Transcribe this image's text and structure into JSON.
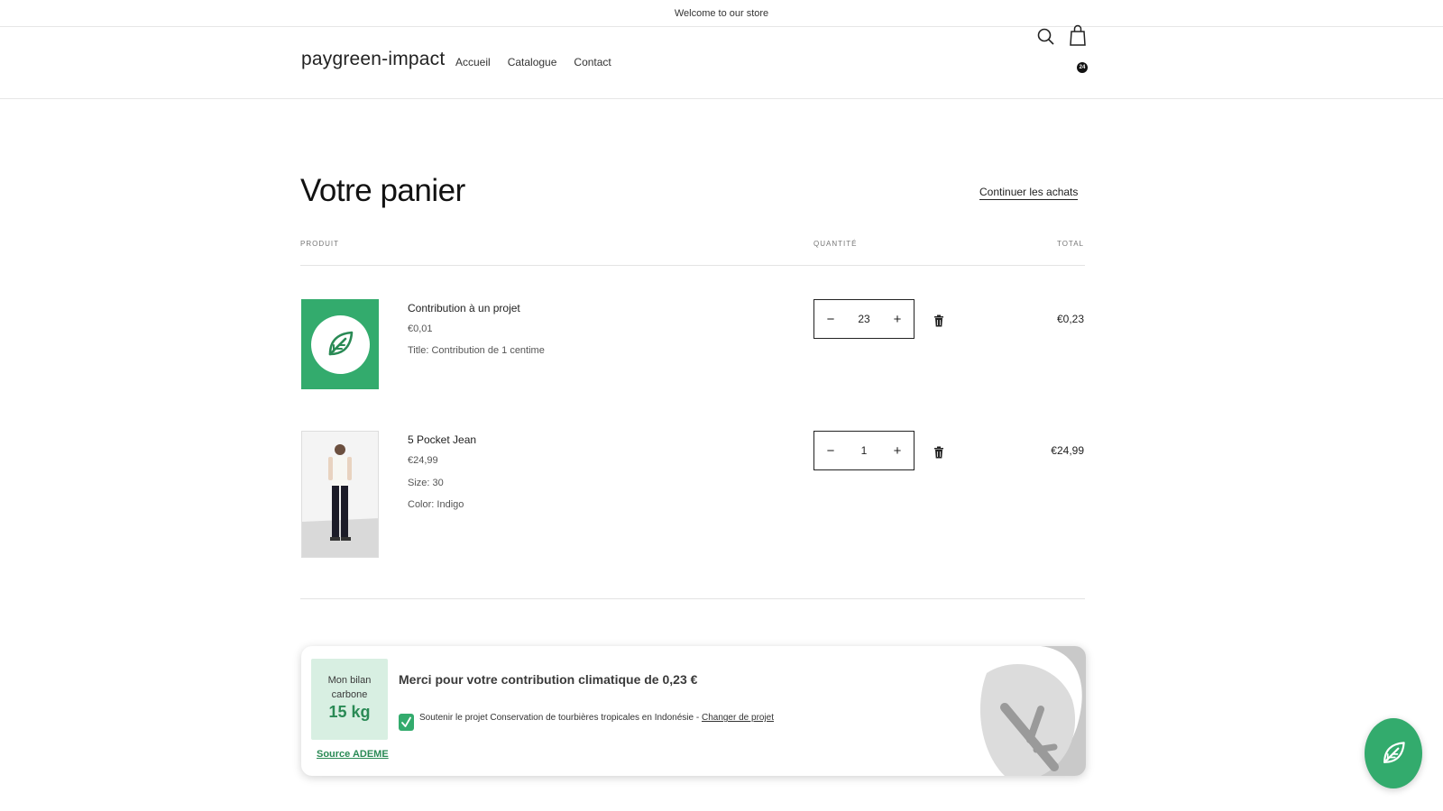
{
  "announcement": "Welcome to our store",
  "header": {
    "logo": "paygreen-impact",
    "nav": [
      "Accueil",
      "Catalogue",
      "Contact"
    ],
    "cart_count": "24"
  },
  "page": {
    "title": "Votre panier",
    "continue_link": "Continuer les achats",
    "columns": {
      "product": "PRODUIT",
      "quantity": "QUANTITÉ",
      "total": "TOTAL"
    }
  },
  "items": [
    {
      "name": "Contribution à un projet",
      "price": "€0,01",
      "details": [
        "Title: Contribution de 1 centime"
      ],
      "quantity": "23",
      "total": "€0,23"
    },
    {
      "name": "5 Pocket Jean",
      "price": "€24,99",
      "details": [
        "Size: 30",
        "Color: Indigo"
      ],
      "quantity": "1",
      "total": "€24,99"
    }
  ],
  "widget": {
    "carbon_label": "Mon bilan carbone",
    "carbon_value": "15 kg",
    "source": "Source ADEME",
    "thanks": "Merci pour votre contribution climatique de 0,23 €",
    "support_text": "Soutenir le projet Conservation de tourbières tropicales en Indonésie - ",
    "change_link": "Changer de projet"
  },
  "colors": {
    "brand_green": "#33ab6d",
    "dark_green": "#2a8a55",
    "carbon_bg": "#d8efe2"
  }
}
